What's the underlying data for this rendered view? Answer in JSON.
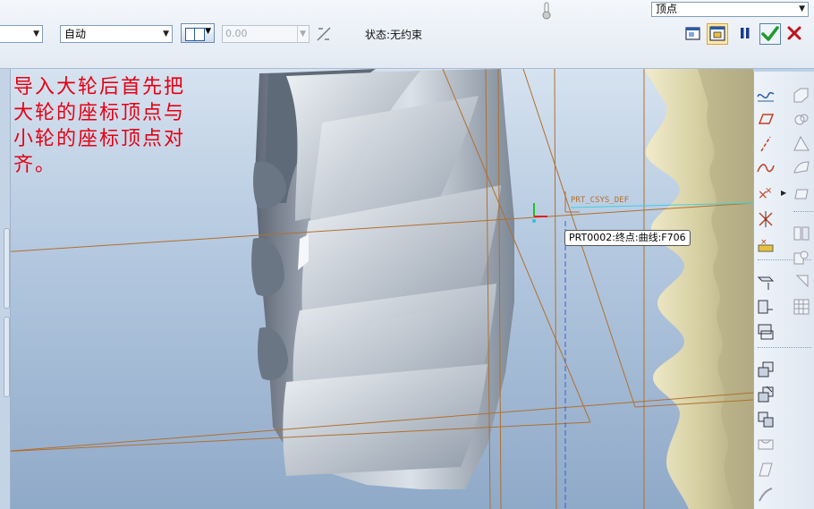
{
  "dashboard": {
    "reference_dropdown": {
      "value": ""
    },
    "mode_dropdown": {
      "value": "自动"
    },
    "offset_input": {
      "value": "0.00"
    },
    "status": "状态:无约束",
    "constraint_type_dropdown": {
      "value": "顶点"
    }
  },
  "viewport": {
    "annotation": "导入大轮后首先把\n大轮的座标顶点与\n小轮的座标顶点对\n齐。",
    "csys_label": "PRT_CSYS_DEF",
    "tooltip": "PRT0002:终点:曲线:F706"
  },
  "colors": {
    "annotation_text": "#e60012",
    "ok_check": "#1f9a2c",
    "cancel_x": "#c0141b",
    "gear_large": "#9aa5b4",
    "gear_small": "#d8d2a8",
    "datum_curve": "#b07030"
  },
  "right_toolbar_icons": [
    "sketch-curve-icon",
    "datum-plane-icon",
    "datum-axis-icon",
    "datum-curve-icon",
    "datum-point-icon",
    "coordinate-system-icon",
    "analysis-icon",
    "extrude-icon",
    "revolve-icon",
    "sweep-icon",
    "blend-icon",
    "mirror-icon",
    "pattern-icon",
    "offset-icon",
    "merge-icon",
    "trim-icon",
    "copy-icon",
    "paste-icon",
    "group-icon",
    "component-icon",
    "shell-icon",
    "round-icon",
    "chamfer-icon",
    "draft-icon"
  ]
}
